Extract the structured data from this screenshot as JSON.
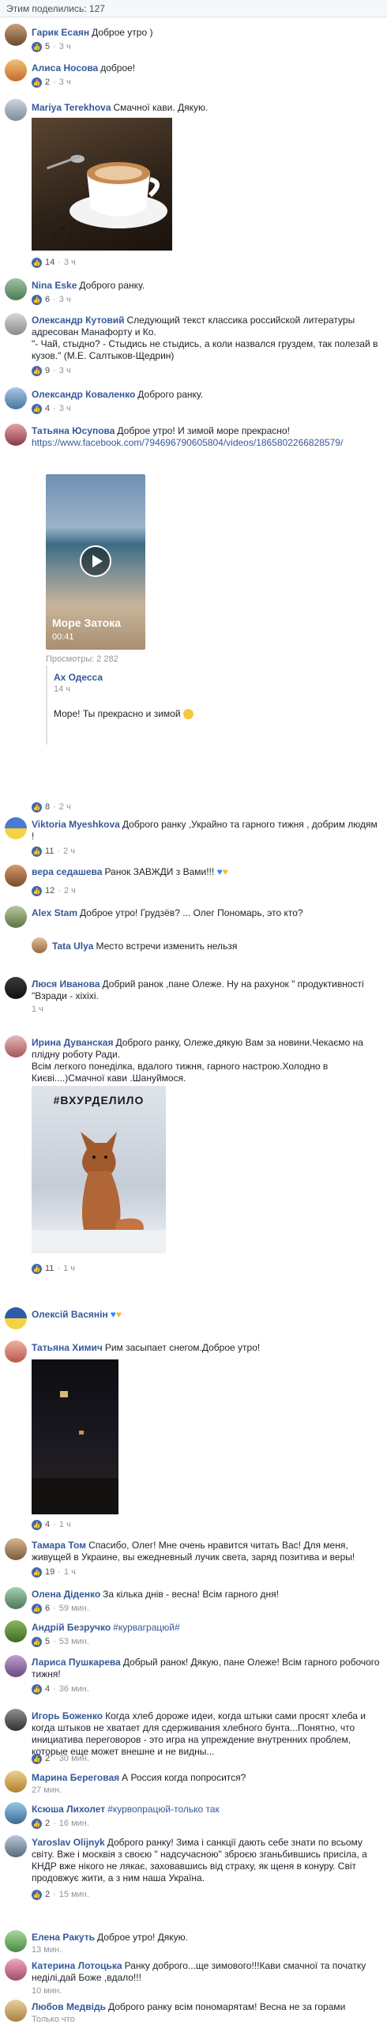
{
  "header": {
    "shares": "Этим поделились: 127"
  },
  "comments": [
    {
      "name": "Гарик Есаян",
      "text": "Доброе утро )",
      "likes": "5",
      "time": "3 ч"
    },
    {
      "name": "Алиса Носова",
      "text": "доброе!",
      "likes": "2",
      "time": "3 ч"
    },
    {
      "name": "Mariya Terekhova",
      "text": "Смачної кави. Дякую.",
      "likes": "14",
      "time": "3 ч"
    },
    {
      "name": "Nina Eske",
      "text": "Доброго ранку.",
      "likes": "6",
      "time": "3 ч"
    },
    {
      "name": "Олександр Кутовий",
      "text": "Следующий текст классика российской литературы адресован Манафорту и Ко.",
      "text2": "\"- Чай, стыдно? - Стыдись не стыдись, а коли назвался груздем, так полезай в кузов.\" (М.Е. Салтыков-Щедрин)",
      "likes": "9",
      "time": "3 ч"
    },
    {
      "name": "Олександр Коваленко",
      "text": "Доброго ранку.",
      "likes": "4",
      "time": "3 ч"
    },
    {
      "name": "Татьяна Юсупова",
      "text": "Доброе утро! И зимой море прекрасно!",
      "link": "https://www.facebook.com/794696790605804/videos/1865802266828579/",
      "video_title": "Море Затока",
      "video_time": "00:41",
      "views": "Просмотры: 2 282",
      "likes": "8",
      "time": "2 ч"
    },
    {
      "name": "Viktoria Myeshkova",
      "text": "Доброго ранку ,Украйно та гарного тижня , добрим людям !",
      "likes": "11",
      "time": "2 ч"
    },
    {
      "name": "вера седашева",
      "text": "Ранок ЗАВЖДИ з Вами!!!",
      "likes": "12",
      "time": "2 ч"
    },
    {
      "name": "Alex Stam",
      "text": "Доброе утро! Грудзёв? ... Олег Пономарь, это кто?",
      "likes": "",
      "time": ""
    },
    {
      "name": "Люся Иванова",
      "text": "Добрий ранок ,пане Олеже. Ну на рахунок \" продуктивності \"Взради - хіхіхі.",
      "likes": "",
      "time": "1 ч"
    },
    {
      "name": "Ирина Дуванская",
      "text": "Доброго ранку, Олеже,дякую Вам за новини.Чекаємо на плідну роботу Ради.",
      "text2": "Всім легкого понеділка, вдалого тижня, гарного настрою.Холодно в Києві....)Смачної кави .Шануймося.",
      "image_text": "#ВХУРДЕЛИЛО",
      "likes": "11",
      "time": "1 ч"
    },
    {
      "name": "Олексій Васянін",
      "text": "",
      "likes": "",
      "time": ""
    },
    {
      "name": "Татьяна Химич",
      "text": "Рим засыпает снегом.Доброе утро!",
      "likes": "4",
      "time": "1 ч"
    },
    {
      "name": "Тамара Том",
      "text": "Спасибо, Олег! Мне очень нравится читать Вас! Для меня, живущей в Украине, вы ежедневный лучик света, заряд позитива и веры!",
      "likes": "19",
      "time": "1 ч"
    },
    {
      "name": "Олена Діденко",
      "text": "За кілька днів - весна! Всім гарного дня!",
      "likes": "6",
      "time": "59 мин."
    },
    {
      "name": "Андрій Безручко",
      "text": "#курваграцюй#",
      "likes": "5",
      "time": "53 мин."
    },
    {
      "name": "Лариса Пушкарева",
      "text": "Добрый ранок! Дякую, пане Олеже! Всім гарного робочого тижня!",
      "likes": "4",
      "time": "36 мин."
    },
    {
      "name": "Игорь Боженко",
      "text": "Когда хлеб дороже идеи, когда штыки сами просят хлеба и когда штыков не хватает для сдерживания хлебного бунта...Понятно, что инициатива переговоров - это игра на упреждение внутренних проблем, которые еще может внешне и не видны...",
      "likes": "2",
      "time": "30 мин."
    },
    {
      "name": "Марина Береговая",
      "text": "А Россия когда попросится?",
      "likes": "",
      "time": "27 мин."
    },
    {
      "name": "Ксюша Лихолет",
      "text": "#курвопрацюй-только так",
      "likes": "2",
      "time": "16 мин."
    },
    {
      "name": "Yaroslav Olijnyk",
      "text": "Доброго ранку! Зима і санкції дають себе знати по всьому світу. Вже і москвія з своєю \" надсучасною\" зброєю зганьбившись присіла, а КНДР вже нікого не лякає, заховавшись від страху, як щеня в конуру. Світ продовжує жити, а з ним наша Україна.",
      "likes": "2",
      "time": "15 мин."
    },
    {
      "name": "Елена Ракуть",
      "text": "Доброе утро! Дякую.",
      "likes": "",
      "time": "13 мин."
    },
    {
      "name": "Катерина Лотоцька",
      "text": "Ранку доброго...ще зимового!!!Кави смачної та початку неділі,дай Боже ,вдало!!!",
      "likes": "",
      "time": "10 мин."
    },
    {
      "name": "Любов Медвідь",
      "text": "Доброго ранку всім пономарятам! Весна не за горами",
      "likes": "",
      "time": "Только что"
    }
  ],
  "reply": {
    "name": "Ах Одесса",
    "time": "14 ч",
    "text": "Море! Ты прекрасно и зимой"
  },
  "reply2": {
    "name": "Tata Ulya",
    "text": "Место встречи изменить нельзя"
  },
  "colors": {
    "link": "#365899",
    "meta": "#90949c",
    "like": "#4267b2"
  }
}
